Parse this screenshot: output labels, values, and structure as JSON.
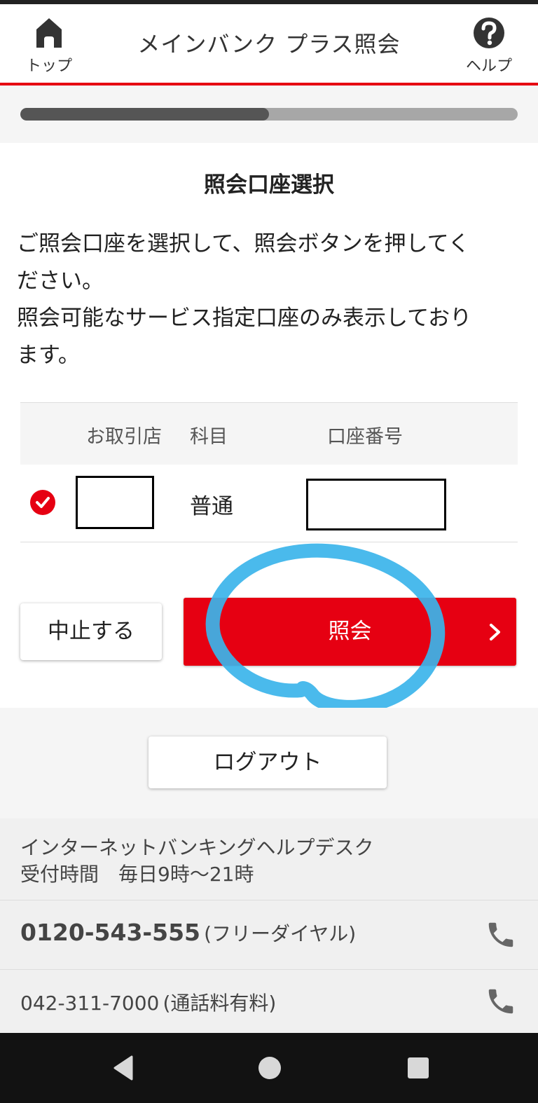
{
  "header": {
    "title": "メインバンク プラス照会",
    "home_label": "トップ",
    "help_label": "ヘルプ"
  },
  "progress": {
    "fraction": 0.5
  },
  "section": {
    "title": "照会口座選択",
    "instructions": [
      "ご照会口座を選択して、照会ボタンを押してく",
      "ださい。",
      "照会可能なサービス指定口座のみ表示しており",
      "ます。"
    ]
  },
  "table": {
    "headers": {
      "branch": "お取引店",
      "type": "科目",
      "account": "口座番号"
    },
    "row": {
      "selected": true,
      "type": "普通"
    }
  },
  "buttons": {
    "cancel": "中止する",
    "inquiry": "照会",
    "logout": "ログアウト"
  },
  "helpdesk": {
    "name": "インターネットバンキングヘルプデスク",
    "hours": "受付時間　毎日9時～21時",
    "phones": [
      {
        "number": "0120-543-555",
        "note": "(フリーダイヤル)"
      },
      {
        "number": "042-311-7000",
        "note": "(通話料有料)"
      }
    ]
  },
  "colors": {
    "accent": "#e60012",
    "highlight_ink": "#3bb4ea",
    "progress_fill": "#555555",
    "progress_track": "#a7a7a7"
  },
  "icons": {
    "home": "home-icon",
    "help": "help-icon",
    "check": "check-circle-icon",
    "chevron": "chevron-right-icon",
    "phone": "phone-icon",
    "back": "back-triangle-icon",
    "home_circle": "home-circle-icon",
    "recents": "recents-square-icon"
  }
}
